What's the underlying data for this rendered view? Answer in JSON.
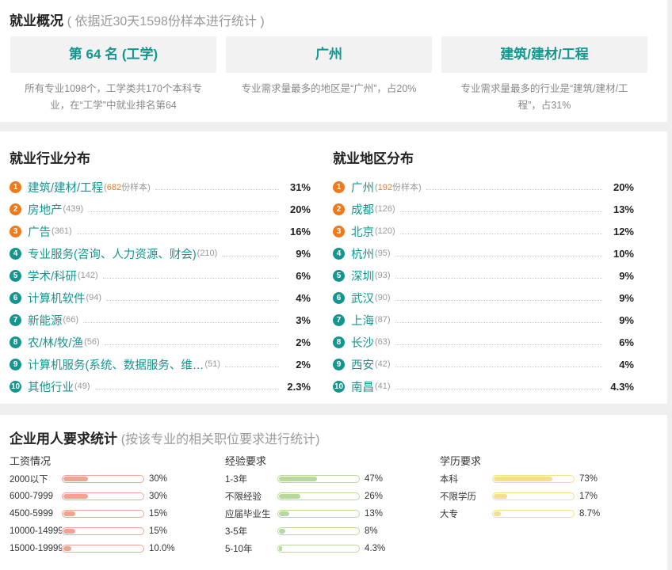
{
  "overview": {
    "title": "就业概况",
    "subtitle": "( 依据近30天1598份样本进行统计 )",
    "boxes": [
      {
        "label": "第 64 名 (工学)",
        "desc": "所有专业1098个，工学类共170个本科专业，在“工学”中就业排名第64"
      },
      {
        "label": "广州",
        "desc": "专业需求量最多的地区是“广州”，占20%"
      },
      {
        "label": "建筑/建材/工程",
        "desc": "专业需求量最多的行业是“建筑/建材/工程”，占31%"
      }
    ]
  },
  "industry": {
    "title": "就业行业分布",
    "items": [
      {
        "rank": "1",
        "name": "建筑/建材/工程",
        "count": "682",
        "count_suffix": "份样本",
        "pct": "31%"
      },
      {
        "rank": "2",
        "name": "房地产",
        "count": "(439)",
        "pct": "20%"
      },
      {
        "rank": "3",
        "name": "广告",
        "count": "(361)",
        "pct": "16%"
      },
      {
        "rank": "4",
        "name": "专业服务(咨询、人力资源、财会)",
        "count": "(210)",
        "pct": "9%"
      },
      {
        "rank": "5",
        "name": "学术/科研",
        "count": "(142)",
        "pct": "6%"
      },
      {
        "rank": "6",
        "name": "计算机软件",
        "count": "(94)",
        "pct": "4%"
      },
      {
        "rank": "7",
        "name": "新能源",
        "count": "(66)",
        "pct": "3%"
      },
      {
        "rank": "8",
        "name": "农/林/牧/渔",
        "count": "(56)",
        "pct": "2%"
      },
      {
        "rank": "9",
        "name": "计算机服务(系统、数据服务、维…",
        "count": "(51)",
        "pct": "2%"
      },
      {
        "rank": "10",
        "name": "其他行业",
        "count": "(49)",
        "pct": "2.3%"
      }
    ]
  },
  "region": {
    "title": "就业地区分布",
    "items": [
      {
        "rank": "1",
        "name": "广州",
        "count": "192",
        "count_suffix": "份样本",
        "pct": "20%"
      },
      {
        "rank": "2",
        "name": "成都",
        "count": "(126)",
        "pct": "13%"
      },
      {
        "rank": "3",
        "name": "北京",
        "count": "(120)",
        "pct": "12%"
      },
      {
        "rank": "4",
        "name": "杭州",
        "count": "(95)",
        "pct": "10%"
      },
      {
        "rank": "5",
        "name": "深圳",
        "count": "(93)",
        "pct": "9%"
      },
      {
        "rank": "6",
        "name": "武汉",
        "count": "(90)",
        "pct": "9%"
      },
      {
        "rank": "7",
        "name": "上海",
        "count": "(87)",
        "pct": "9%"
      },
      {
        "rank": "8",
        "name": "长沙",
        "count": "(63)",
        "pct": "6%"
      },
      {
        "rank": "9",
        "name": "西安",
        "count": "(42)",
        "pct": "4%"
      },
      {
        "rank": "10",
        "name": "南昌",
        "count": "(41)",
        "pct": "4.3%"
      }
    ]
  },
  "requirements": {
    "title": "企业用人要求统计",
    "subtitle": "(按该专业的相关职位要求进行统计)",
    "salary": {
      "title": "工资情况",
      "items": [
        {
          "label": "2000以下",
          "value": 0.3,
          "text": "30%"
        },
        {
          "label": "6000-7999",
          "value": 0.3,
          "text": "30%"
        },
        {
          "label": "4500-5999",
          "value": 0.15,
          "text": "15%"
        },
        {
          "label": "10000-14999",
          "value": 0.15,
          "text": "15%"
        },
        {
          "label": "15000-19999",
          "value": 0.1,
          "text": "10.0%"
        }
      ]
    },
    "experience": {
      "title": "经验要求",
      "items": [
        {
          "label": "1-3年",
          "value": 0.47,
          "text": "47%"
        },
        {
          "label": "不限经验",
          "value": 0.26,
          "text": "26%"
        },
        {
          "label": "应届毕业生",
          "value": 0.13,
          "text": "13%"
        },
        {
          "label": "3-5年",
          "value": 0.08,
          "text": "8%"
        },
        {
          "label": "5-10年",
          "value": 0.043,
          "text": "4.3%"
        }
      ]
    },
    "education": {
      "title": "学历要求",
      "items": [
        {
          "label": "本科",
          "value": 0.73,
          "text": "73%"
        },
        {
          "label": "不限学历",
          "value": 0.17,
          "text": "17%"
        },
        {
          "label": "大专",
          "value": 0.087,
          "text": "8.7%"
        }
      ]
    }
  },
  "colors": {
    "teal": "#14968f",
    "orange": "#f07a1b",
    "salary_bar": "#f0a393",
    "experience_bar": "#b8d99a",
    "education_bar": "#f5df8a"
  }
}
